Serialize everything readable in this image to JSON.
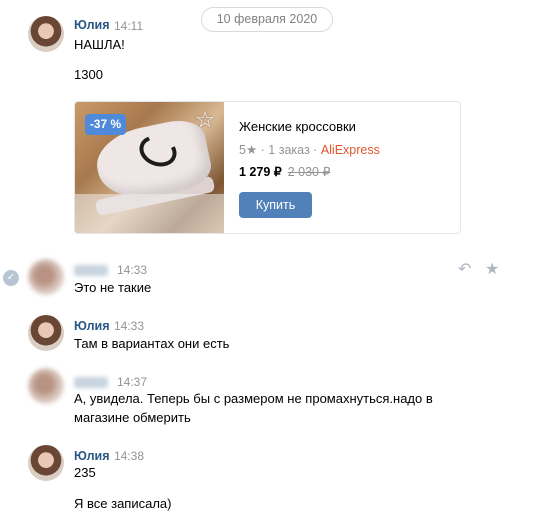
{
  "date_divider": "10 февраля 2020",
  "messages": [
    {
      "author": "Юлия",
      "time": "14:11",
      "lines": [
        "НАШЛА!",
        "1300"
      ]
    },
    {
      "author": "",
      "time": "14:33",
      "lines": [
        "Это не такие"
      ]
    },
    {
      "author": "Юлия",
      "time": "14:33",
      "lines": [
        "Там в вариантах они есть"
      ]
    },
    {
      "author": "",
      "time": "14:37",
      "lines": [
        "А, увидела. Теперь бы с размером не промахнуться.надо в",
        "магазине обмерить"
      ]
    },
    {
      "author": "Юлия",
      "time": "14:38",
      "lines": [
        "235",
        "Я все записала)"
      ]
    }
  ],
  "product_card": {
    "discount": "-37 %",
    "title": "Женские кроссовки",
    "rating": "5",
    "orders": "· 1 заказ ·",
    "store": "AliExpress",
    "price": "1 279 ₽",
    "old_price": "2 030 ₽",
    "buy_label": "Купить"
  },
  "icons": {
    "read_check": "check-icon",
    "reply": "reply-icon",
    "favorite": "star-icon"
  },
  "colors": {
    "author_name": "#2a5885",
    "button": "#5181b8",
    "discount_badge": "#4e8ad9",
    "store": "#e0572d"
  }
}
